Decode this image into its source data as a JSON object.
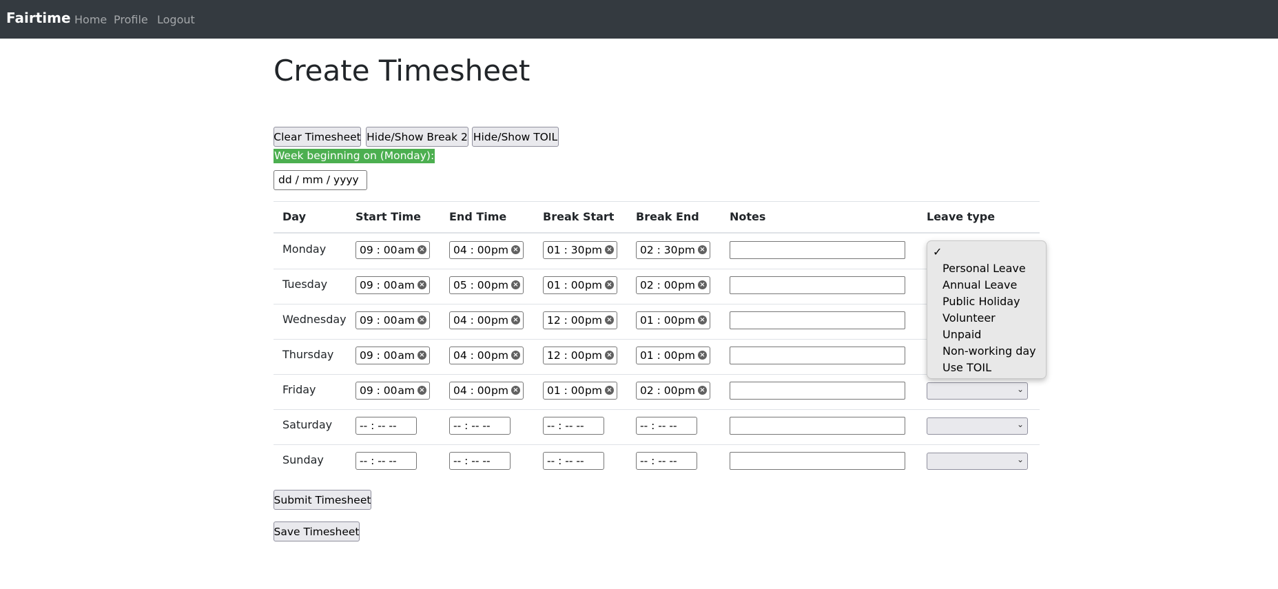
{
  "nav": {
    "brand": "Fairtime",
    "links": [
      "Home",
      "Profile",
      "Logout"
    ]
  },
  "page_title": "Create Timesheet",
  "toolbar": {
    "clear": "Clear Timesheet",
    "hide_break2": "Hide/Show Break 2",
    "hide_toil": "Hide/Show TOIL"
  },
  "week": {
    "label": "Week beginning on (Monday):",
    "placeholder": "dd / mm / yyyy"
  },
  "table": {
    "headers": [
      "Day",
      "Start Time",
      "End Time",
      "Break Start",
      "Break End",
      "Notes",
      "Leave type"
    ],
    "rows": [
      {
        "day": "Monday",
        "start": [
          "09 : 00",
          "am"
        ],
        "end": [
          "04 : 00",
          "pm"
        ],
        "bstart": [
          "01 : 30",
          "pm"
        ],
        "bend": [
          "02 : 30",
          "pm"
        ]
      },
      {
        "day": "Tuesday",
        "start": [
          "09 : 00",
          "am"
        ],
        "end": [
          "05 : 00",
          "pm"
        ],
        "bstart": [
          "01 : 00",
          "pm"
        ],
        "bend": [
          "02 : 00",
          "pm"
        ]
      },
      {
        "day": "Wednesday",
        "start": [
          "09 : 00",
          "am"
        ],
        "end": [
          "04 : 00",
          "pm"
        ],
        "bstart": [
          "12 : 00",
          "pm"
        ],
        "bend": [
          "01 : 00",
          "pm"
        ]
      },
      {
        "day": "Thursday",
        "start": [
          "09 : 00",
          "am"
        ],
        "end": [
          "04 : 00",
          "pm"
        ],
        "bstart": [
          "12 : 00",
          "pm"
        ],
        "bend": [
          "01 : 00",
          "pm"
        ]
      },
      {
        "day": "Friday",
        "start": [
          "09 : 00",
          "am"
        ],
        "end": [
          "04 : 00",
          "pm"
        ],
        "bstart": [
          "01 : 00",
          "pm"
        ],
        "bend": [
          "02 : 00",
          "pm"
        ]
      },
      {
        "day": "Saturday",
        "empty": "-- : --  --"
      },
      {
        "day": "Sunday",
        "empty": "-- : --  --"
      }
    ]
  },
  "leave_dropdown": {
    "check": "✓",
    "options": [
      "Personal Leave",
      "Annual Leave",
      "Public Holiday",
      "Volunteer",
      "Unpaid",
      "Non-working day",
      "Use TOIL"
    ]
  },
  "actions": {
    "submit": "Submit Timesheet",
    "save": "Save Timesheet"
  }
}
